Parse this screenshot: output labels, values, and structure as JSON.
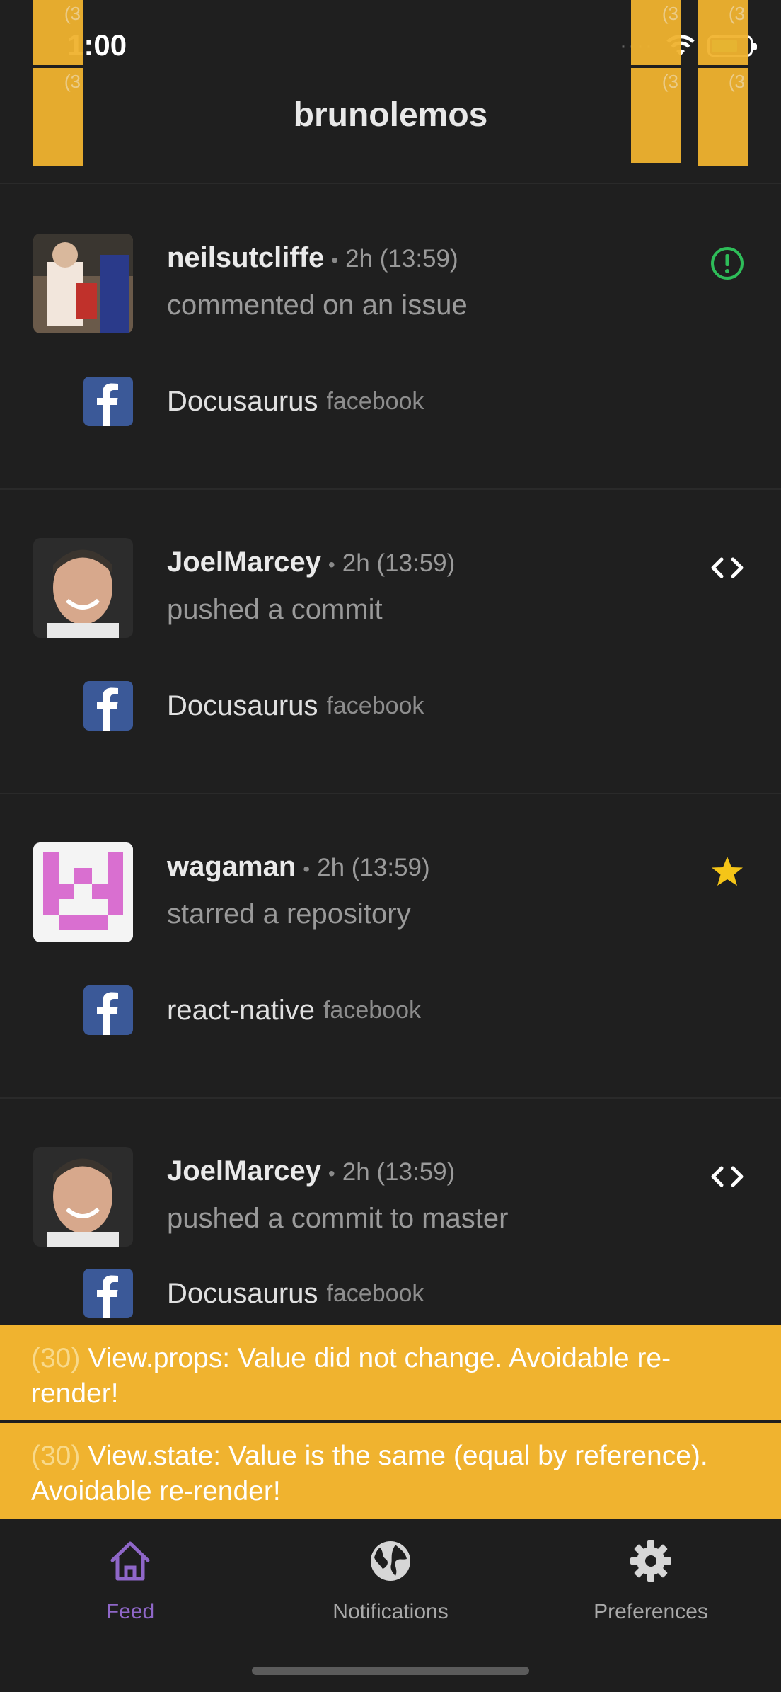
{
  "status": {
    "time": "1:00"
  },
  "header": {
    "title": "brunolemos"
  },
  "overlay_labels": {
    "top": "(3",
    "paren": "(3"
  },
  "feed": [
    {
      "username": "neilsutcliffe",
      "time": "2h (13:59)",
      "action": "commented on an issue",
      "icon": "issue-open-icon",
      "repo": "Docusaurus",
      "owner": "facebook",
      "icon_color": "#2ebd59"
    },
    {
      "username": "JoelMarcey",
      "time": "2h (13:59)",
      "action": "pushed a commit",
      "icon": "code-icon",
      "repo": "Docusaurus",
      "owner": "facebook",
      "icon_color": "#ffffff"
    },
    {
      "username": "wagaman",
      "time": "2h (13:59)",
      "action": "starred a repository",
      "icon": "star-icon",
      "repo": "react-native",
      "owner": "facebook",
      "icon_color": "#f5c518"
    },
    {
      "username": "JoelMarcey",
      "time": "2h (13:59)",
      "action": "pushed a commit to master",
      "icon": "code-icon",
      "repo": "Docusaurus",
      "owner": "facebook",
      "icon_color": "#ffffff"
    }
  ],
  "warnings": [
    {
      "count": "(30)",
      "text": " View.props: Value did not change. Avoidable re-render!"
    },
    {
      "count": "(30)",
      "text": " View.state: Value is the same (equal by reference). Avoidable re-render!"
    }
  ],
  "tabs": [
    {
      "label": "Feed",
      "icon": "home-icon",
      "active": true
    },
    {
      "label": "Notifications",
      "icon": "globe-icon",
      "active": false
    },
    {
      "label": "Preferences",
      "icon": "gear-icon",
      "active": false
    }
  ],
  "colors": {
    "accent": "#8f67c8",
    "warning": "#f0b32f",
    "background": "#1f1f1f"
  }
}
